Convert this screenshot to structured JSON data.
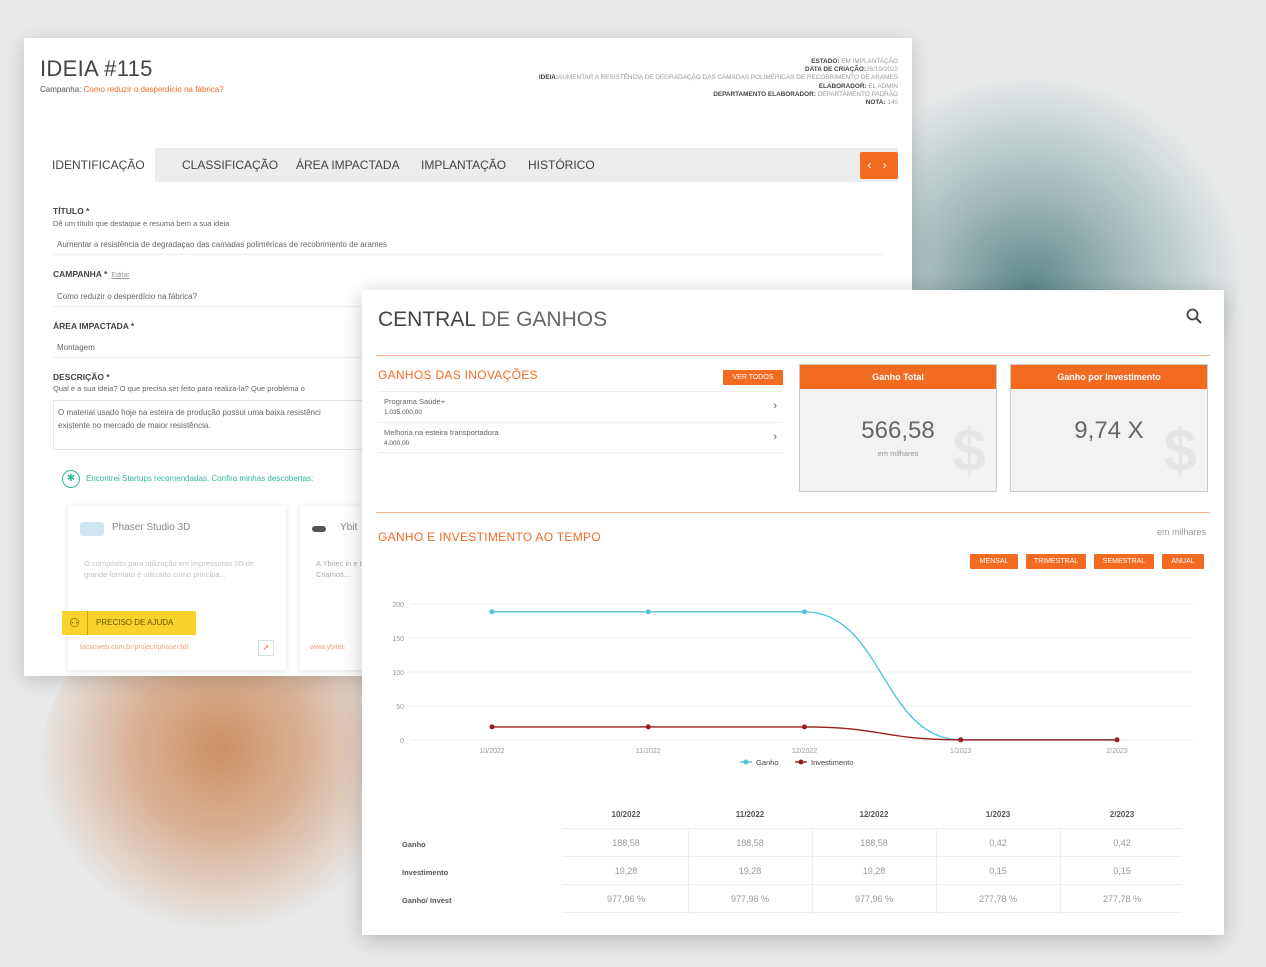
{
  "idea": {
    "title": "IDEIA #115",
    "campaign_label": "Campanha:",
    "campaign_link": "Como reduzir o desperdício na fábrica?",
    "meta": {
      "estado_label": "ESTADO:",
      "estado_value": "EM IMPLANTAÇÃO",
      "data_label": "DATA DE CRIAÇÃO:",
      "data_value": "26/10/2022",
      "ideia_label": "IDEIA:",
      "ideia_value": "AUMENTAR A RESISTÊNCIA DE DEGRADAÇÃO DAS CAMADAS POLIMÉRICAS DE RECOBRIMENTO DE ARAMES",
      "elaborador_label": "ELABORADOR:",
      "elaborador_value": "EL ADMIN",
      "depto_label": "DEPARTAMENTO ELABORADOR:",
      "depto_value": "DEPARTAMENTO PADRÃO",
      "nota_label": "NOTA:",
      "nota_value": "140"
    },
    "tabs": [
      "IDENTIFICAÇÃO",
      "CLASSIFICAÇÃO",
      "ÁREA IMPACTADA",
      "IMPLANTAÇÃO",
      "HISTÓRICO"
    ],
    "tab_nav": "‹ ›",
    "fields": {
      "titulo_label": "TÍTULO *",
      "titulo_help": "Dê um título que destaque e resuma bem a sua ideia",
      "titulo_value": "Aumentar a resistência de degradaçao das camadas poliméricas de recobrimento de arames",
      "campanha_label": "CAMPANHA *",
      "campanha_edit": "Editar",
      "campanha_value": "Como reduzir o desperdício na fábrica?",
      "area_label": "ÁREA IMPACTADA *",
      "area_value": "Montagem",
      "descricao_label": "DESCRIÇÃO *",
      "descricao_help": "Qual é a sua ideia? O que precisa ser feito para realizá-la? Que problema o",
      "descricao_value_1": "O material usado hoje na esteira de produção possui uma baixa resistênci",
      "descricao_value_2": "existente no mercado de maior resistência."
    },
    "startups_note": "Encontrei Startups recomendadas. Confira minhas descobertas:",
    "startups": [
      {
        "name": "Phaser Studio 3D",
        "desc": "O compósito para utilização em impressoras 3D de grande formato é utilizado como principa...",
        "url": "tacticweb.com.br/project/phaser3d/"
      },
      {
        "name": "Ybit",
        "desc": "A Ybitec in e têxtil com Criamos...",
        "url": "www.ybitec"
      }
    ],
    "help_button": "PRECISO DE AJUDA"
  },
  "gains": {
    "title_bold": "CENTRAL",
    "title_rest": " DE GANHOS",
    "innovations_title": "GANHOS DAS INOVAÇÕES",
    "ver_todos": "VER TODOS",
    "innovations": [
      {
        "name": "Programa Saúde+",
        "value": "1.035.000,00"
      },
      {
        "name": "Melhoria na esteira transportadora",
        "value": "4.000,00"
      }
    ],
    "kpis": [
      {
        "header": "Ganho Total",
        "value": "566,58",
        "sub": "em milhares",
        "mark": "$"
      },
      {
        "header": "Ganho por Investimento",
        "value": "9,74 X",
        "sub": "",
        "mark": "$"
      }
    ],
    "time_title": "GANHO E INVESTIMENTO AO TEMPO",
    "em_milhares": "em milhares",
    "periods": [
      "MENSAL",
      "TRIMESTRAL",
      "SEMESTRAL",
      "ANUAL"
    ],
    "table": {
      "headers": [
        "10/2022",
        "11/2022",
        "12/2022",
        "1/2023",
        "2/2023"
      ],
      "rows": [
        {
          "label": "Ganho",
          "values": [
            "188,58",
            "188,58",
            "188,58",
            "0,42",
            "0,42"
          ]
        },
        {
          "label": "Investimento",
          "values": [
            "19,28",
            "19,28",
            "19,28",
            "0,15",
            "0,15"
          ]
        },
        {
          "label": "Ganho/ Invest",
          "values": [
            "977,96 %",
            "977,96 %",
            "977,96 %",
            "277,78 %",
            "277,78 %"
          ]
        }
      ]
    }
  },
  "chart_data": {
    "type": "line",
    "x": [
      "10/2022",
      "11/2022",
      "12/2022",
      "1/2023",
      "2/2023"
    ],
    "yticks": [
      0,
      50,
      100,
      150,
      200
    ],
    "ylim": [
      0,
      200
    ],
    "grid": true,
    "legend": "bottom",
    "series": [
      {
        "name": "Ganho",
        "color": "#4fc3e0",
        "values": [
          188.58,
          188.58,
          188.58,
          0.42,
          0.42
        ]
      },
      {
        "name": "Investimento",
        "color": "#9b1c1c",
        "values": [
          19.28,
          19.28,
          19.28,
          0.15,
          0.15
        ]
      }
    ]
  }
}
